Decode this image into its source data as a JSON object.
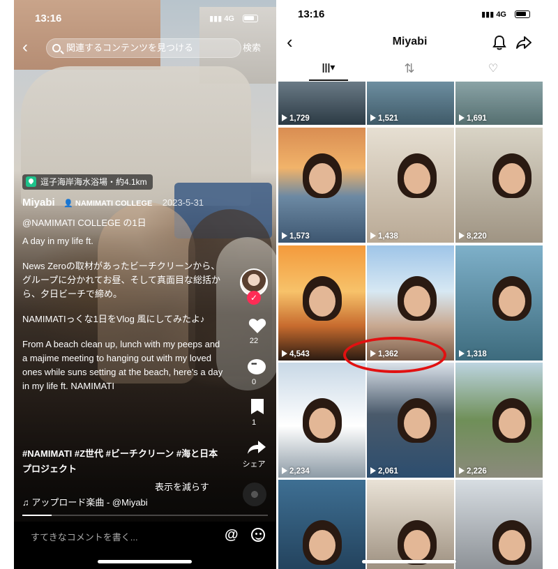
{
  "left": {
    "status": {
      "time": "13:16",
      "network": "4G"
    },
    "search": {
      "placeholder": "関連するコンテンツを見つける",
      "button_label": "検索"
    },
    "location": {
      "label": "逗子海岸海水浴場・約4.1km"
    },
    "author": {
      "name": "Miyabi",
      "badge": "NAMIMATI COLLEGE",
      "date": "2023-5-31"
    },
    "description": {
      "line1": "@NAMIMATI COLLEGE の1日",
      "line2": "A day in my life ft.",
      "para1": "News Zeroの取材があったビーチクリーンから、グループに分かれてお昼、そして真面目な総括から、夕日ビーチで締め。",
      "para2": "NAMIMATIっくな1日をVlog 風にしてみたよ♪",
      "para3": "From A beach clean up, lunch with my peeps and a majime meeting to hanging out with my loved ones while suns setting at the beach, here's a day in my life ft. NAMIMATI"
    },
    "hashtags": "#NAMIMATI #Z世代 #ビーチクリーン #海と日本プロジェクト",
    "show_less": "表示を減らす",
    "music": "♫ アップロード楽曲 - @Miyabi",
    "progress": 0.12,
    "actions": {
      "likes": "22",
      "comments": "0",
      "saves": "1",
      "share": "シェア"
    },
    "comment_placeholder": "すてきなコメントを書く..."
  },
  "right": {
    "status": {
      "time": "13:16",
      "network": "4G"
    },
    "title": "Miyabi",
    "tabs": [
      "videos",
      "reposts",
      "liked"
    ],
    "videos": [
      {
        "views": "1,729"
      },
      {
        "views": "1,521"
      },
      {
        "views": "1,691"
      },
      {
        "views": "1,573"
      },
      {
        "views": "1,438"
      },
      {
        "views": "8,220"
      },
      {
        "views": "4,543"
      },
      {
        "views": "1,362"
      },
      {
        "views": "1,318"
      },
      {
        "views": "2,234"
      },
      {
        "views": "2,061"
      },
      {
        "views": "2,226"
      }
    ],
    "highlight_color": "#e11111"
  }
}
